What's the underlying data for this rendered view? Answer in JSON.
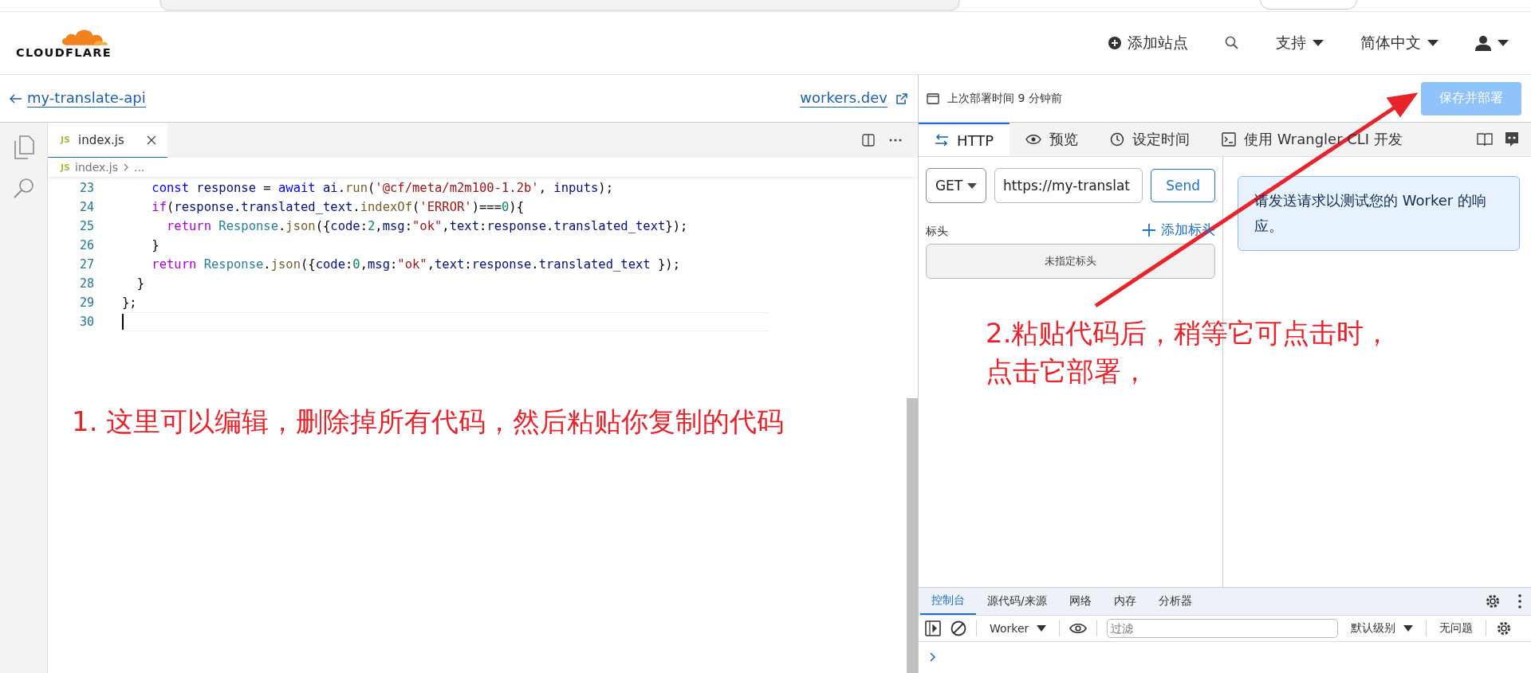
{
  "header": {
    "logo_text": "CLOUDFLARE",
    "nav": [
      {
        "kind": "add",
        "label": "添加站点"
      },
      {
        "kind": "search"
      },
      {
        "kind": "menu",
        "label": "支持"
      },
      {
        "kind": "menu",
        "label": "简体中文"
      },
      {
        "kind": "account"
      }
    ]
  },
  "worker": {
    "back_label": "my-translate-api",
    "link": "workers.dev",
    "deploy_info": "上次部署时间 9 分钟前",
    "deploy_button": "保存并部署"
  },
  "editor": {
    "tabs": [
      {
        "badge": "JS",
        "label": "index.js",
        "selected": true
      }
    ],
    "breadcrumb": {
      "badge": "JS",
      "file": "index.js",
      "rest": "..."
    },
    "lines": [
      {
        "number": "23",
        "current": false,
        "tokens": [
          {
            "kind": "kw",
            "text": "    const "
          },
          {
            "kind": "var",
            "text": "response"
          },
          {
            "kind": "plain",
            "text": " = "
          },
          {
            "kind": "kw",
            "text": "await "
          },
          {
            "kind": "var",
            "text": "ai"
          },
          {
            "kind": "plain",
            "text": "."
          },
          {
            "kind": "fn",
            "text": "run"
          },
          {
            "kind": "plain",
            "text": "("
          },
          {
            "kind": "str",
            "text": "'@cf/meta/m2m100-1.2b'"
          },
          {
            "kind": "plain",
            "text": ", "
          },
          {
            "kind": "var",
            "text": "inputs"
          },
          {
            "kind": "plain",
            "text": ");"
          }
        ]
      },
      {
        "number": "24",
        "current": false,
        "tokens": [
          {
            "kind": "ctl",
            "text": "    if"
          },
          {
            "kind": "plain",
            "text": "("
          },
          {
            "kind": "var",
            "text": "response"
          },
          {
            "kind": "plain",
            "text": "."
          },
          {
            "kind": "var",
            "text": "translated_text"
          },
          {
            "kind": "plain",
            "text": "."
          },
          {
            "kind": "fn",
            "text": "indexOf"
          },
          {
            "kind": "plain",
            "text": "("
          },
          {
            "kind": "str",
            "text": "'ERROR'"
          },
          {
            "kind": "plain",
            "text": ")==="
          },
          {
            "kind": "num",
            "text": "0"
          },
          {
            "kind": "plain",
            "text": "){"
          }
        ]
      },
      {
        "number": "25",
        "current": false,
        "tokens": [
          {
            "kind": "ctl",
            "text": "      return "
          },
          {
            "kind": "cls",
            "text": "Response"
          },
          {
            "kind": "plain",
            "text": "."
          },
          {
            "kind": "fn",
            "text": "json"
          },
          {
            "kind": "plain",
            "text": "({"
          },
          {
            "kind": "var",
            "text": "code"
          },
          {
            "kind": "plain",
            "text": ":"
          },
          {
            "kind": "num",
            "text": "2"
          },
          {
            "kind": "plain",
            "text": ","
          },
          {
            "kind": "var",
            "text": "msg"
          },
          {
            "kind": "plain",
            "text": ":"
          },
          {
            "kind": "str",
            "text": "\"ok\""
          },
          {
            "kind": "plain",
            "text": ","
          },
          {
            "kind": "var",
            "text": "text"
          },
          {
            "kind": "plain",
            "text": ":"
          },
          {
            "kind": "var",
            "text": "response"
          },
          {
            "kind": "plain",
            "text": "."
          },
          {
            "kind": "var",
            "text": "translated_text"
          },
          {
            "kind": "plain",
            "text": "});"
          }
        ]
      },
      {
        "number": "26",
        "current": false,
        "tokens": [
          {
            "kind": "plain",
            "text": "    }"
          }
        ]
      },
      {
        "number": "27",
        "current": false,
        "tokens": [
          {
            "kind": "ctl",
            "text": "    return "
          },
          {
            "kind": "cls",
            "text": "Response"
          },
          {
            "kind": "plain",
            "text": "."
          },
          {
            "kind": "fn",
            "text": "json"
          },
          {
            "kind": "plain",
            "text": "({"
          },
          {
            "kind": "var",
            "text": "code"
          },
          {
            "kind": "plain",
            "text": ":"
          },
          {
            "kind": "num",
            "text": "0"
          },
          {
            "kind": "plain",
            "text": ","
          },
          {
            "kind": "var",
            "text": "msg"
          },
          {
            "kind": "plain",
            "text": ":"
          },
          {
            "kind": "str",
            "text": "\"ok\""
          },
          {
            "kind": "plain",
            "text": ","
          },
          {
            "kind": "var",
            "text": "text"
          },
          {
            "kind": "plain",
            "text": ":"
          },
          {
            "kind": "var",
            "text": "response"
          },
          {
            "kind": "plain",
            "text": "."
          },
          {
            "kind": "var",
            "text": "translated_text"
          },
          {
            "kind": "plain",
            "text": " });"
          }
        ]
      },
      {
        "number": "28",
        "current": false,
        "tokens": [
          {
            "kind": "plain",
            "text": "  }"
          }
        ]
      },
      {
        "number": "29",
        "current": false,
        "tokens": [
          {
            "kind": "plain",
            "text": "};"
          }
        ]
      },
      {
        "number": "30",
        "current": true
      }
    ]
  },
  "tester": {
    "tabs": [
      {
        "label": "HTTP",
        "selected": true
      },
      {
        "label": "预览",
        "selected": false
      },
      {
        "label": "设定时间",
        "selected": false
      },
      {
        "label": "使用 Wrangler CLI 开发",
        "selected": false
      }
    ],
    "method": "GET",
    "url": "https://my-translat",
    "send": "Send",
    "headers_label": "标头",
    "add_header": "添加标头",
    "no_headers": "未指定标头",
    "response_note": "请发送请求以测试您的 Worker 的响应。"
  },
  "devtools": {
    "tabs": [
      {
        "label": "控制台",
        "selected": true
      },
      {
        "label": "源代码/来源",
        "selected": false
      },
      {
        "label": "网络",
        "selected": false
      },
      {
        "label": "内存",
        "selected": false
      },
      {
        "label": "分析器",
        "selected": false
      }
    ],
    "context": "Worker",
    "filter_placeholder": "过滤",
    "level": "默认级别",
    "issues": "无问题"
  },
  "annotations": [
    {
      "lines": [
        "1. 这里可以编辑，删除掉所有代码，然后粘贴你复制的代码"
      ]
    },
    {
      "lines": [
        "2.粘贴代码后，稍等它可点击时，",
        "点击它部署，"
      ]
    }
  ]
}
